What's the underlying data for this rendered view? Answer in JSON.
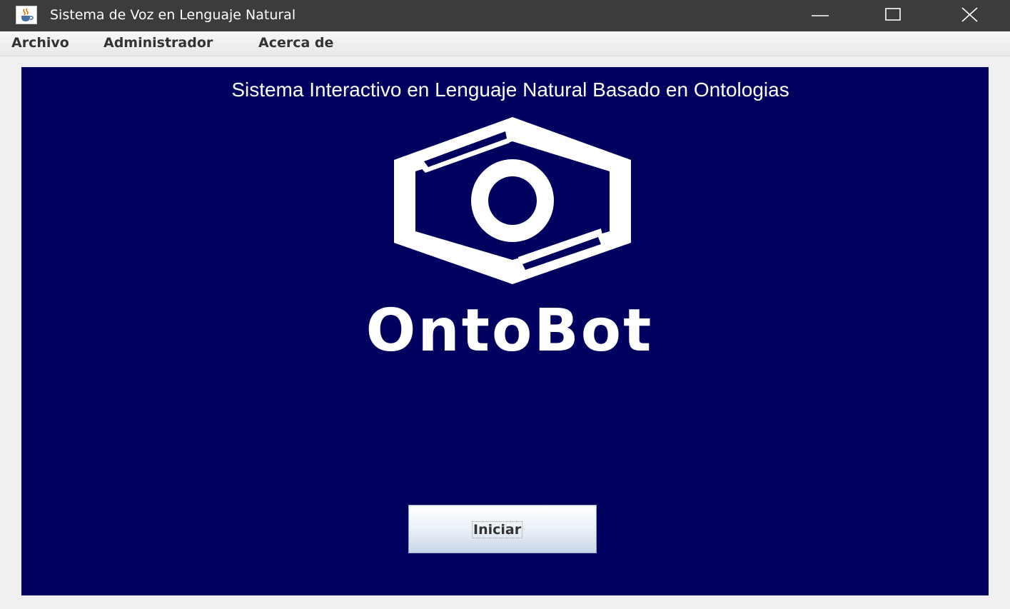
{
  "window": {
    "title": "Sistema de Voz en Lenguaje Natural",
    "app_icon": "java-cup-icon",
    "controls": {
      "minimize_icon": "minimize-icon",
      "maximize_icon": "maximize-icon",
      "close_icon": "close-icon"
    }
  },
  "menubar": {
    "items": [
      {
        "label": "Archivo"
      },
      {
        "label": "Administrador"
      },
      {
        "label": "Acerca de"
      }
    ]
  },
  "main": {
    "heading": "Sistema Interactivo en Lenguaje Natural Basado en Ontologias",
    "logo_icon": "hexagon-ring-logo-icon",
    "brand_name": "OntoBot",
    "start_button_label": "Iniciar"
  },
  "colors": {
    "panel_background": "#00005e",
    "logo_foreground": "#ffffff",
    "titlebar_background": "#3c3c3c"
  }
}
